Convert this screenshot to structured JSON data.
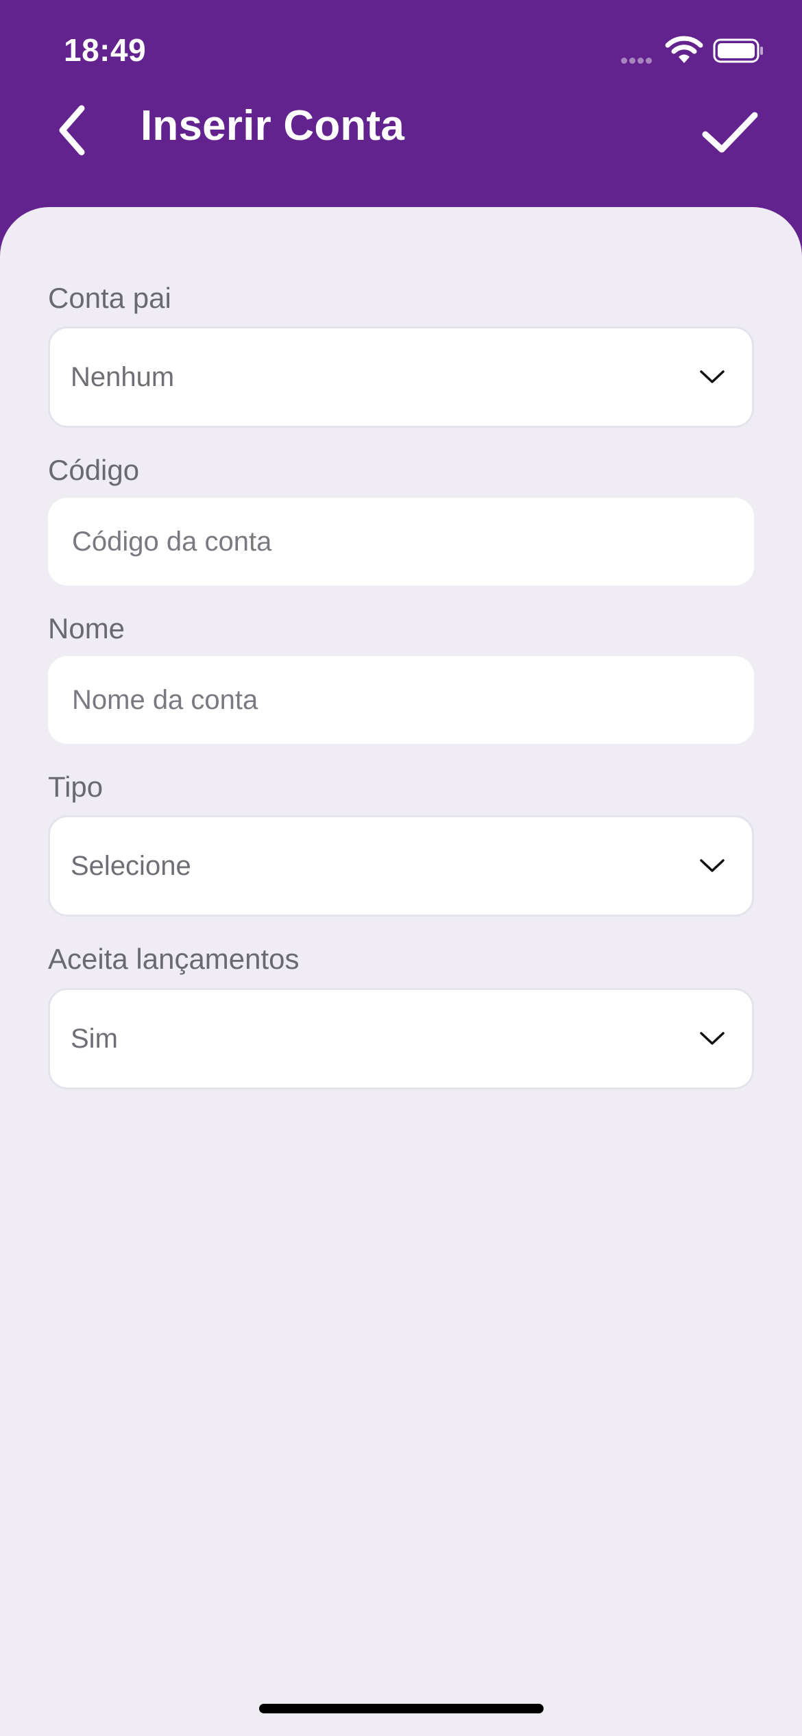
{
  "status_bar": {
    "time": "18:49"
  },
  "nav": {
    "title": "Inserir Conta",
    "back_icon": "chevron-left-icon",
    "confirm_icon": "checkmark-icon"
  },
  "form": {
    "parent_account": {
      "label": "Conta pai",
      "value": "Nenhum"
    },
    "code": {
      "label": "Código",
      "placeholder": "Código da conta",
      "value": ""
    },
    "name": {
      "label": "Nome",
      "placeholder": "Nome da conta",
      "value": ""
    },
    "type": {
      "label": "Tipo",
      "value": "Selecione"
    },
    "accepts_entries": {
      "label": "Aceita lançamentos",
      "value": "Sim"
    }
  },
  "colors": {
    "header": "#62238f",
    "background": "#efecf4",
    "field": "#ffffff",
    "label": "#6b6970"
  }
}
